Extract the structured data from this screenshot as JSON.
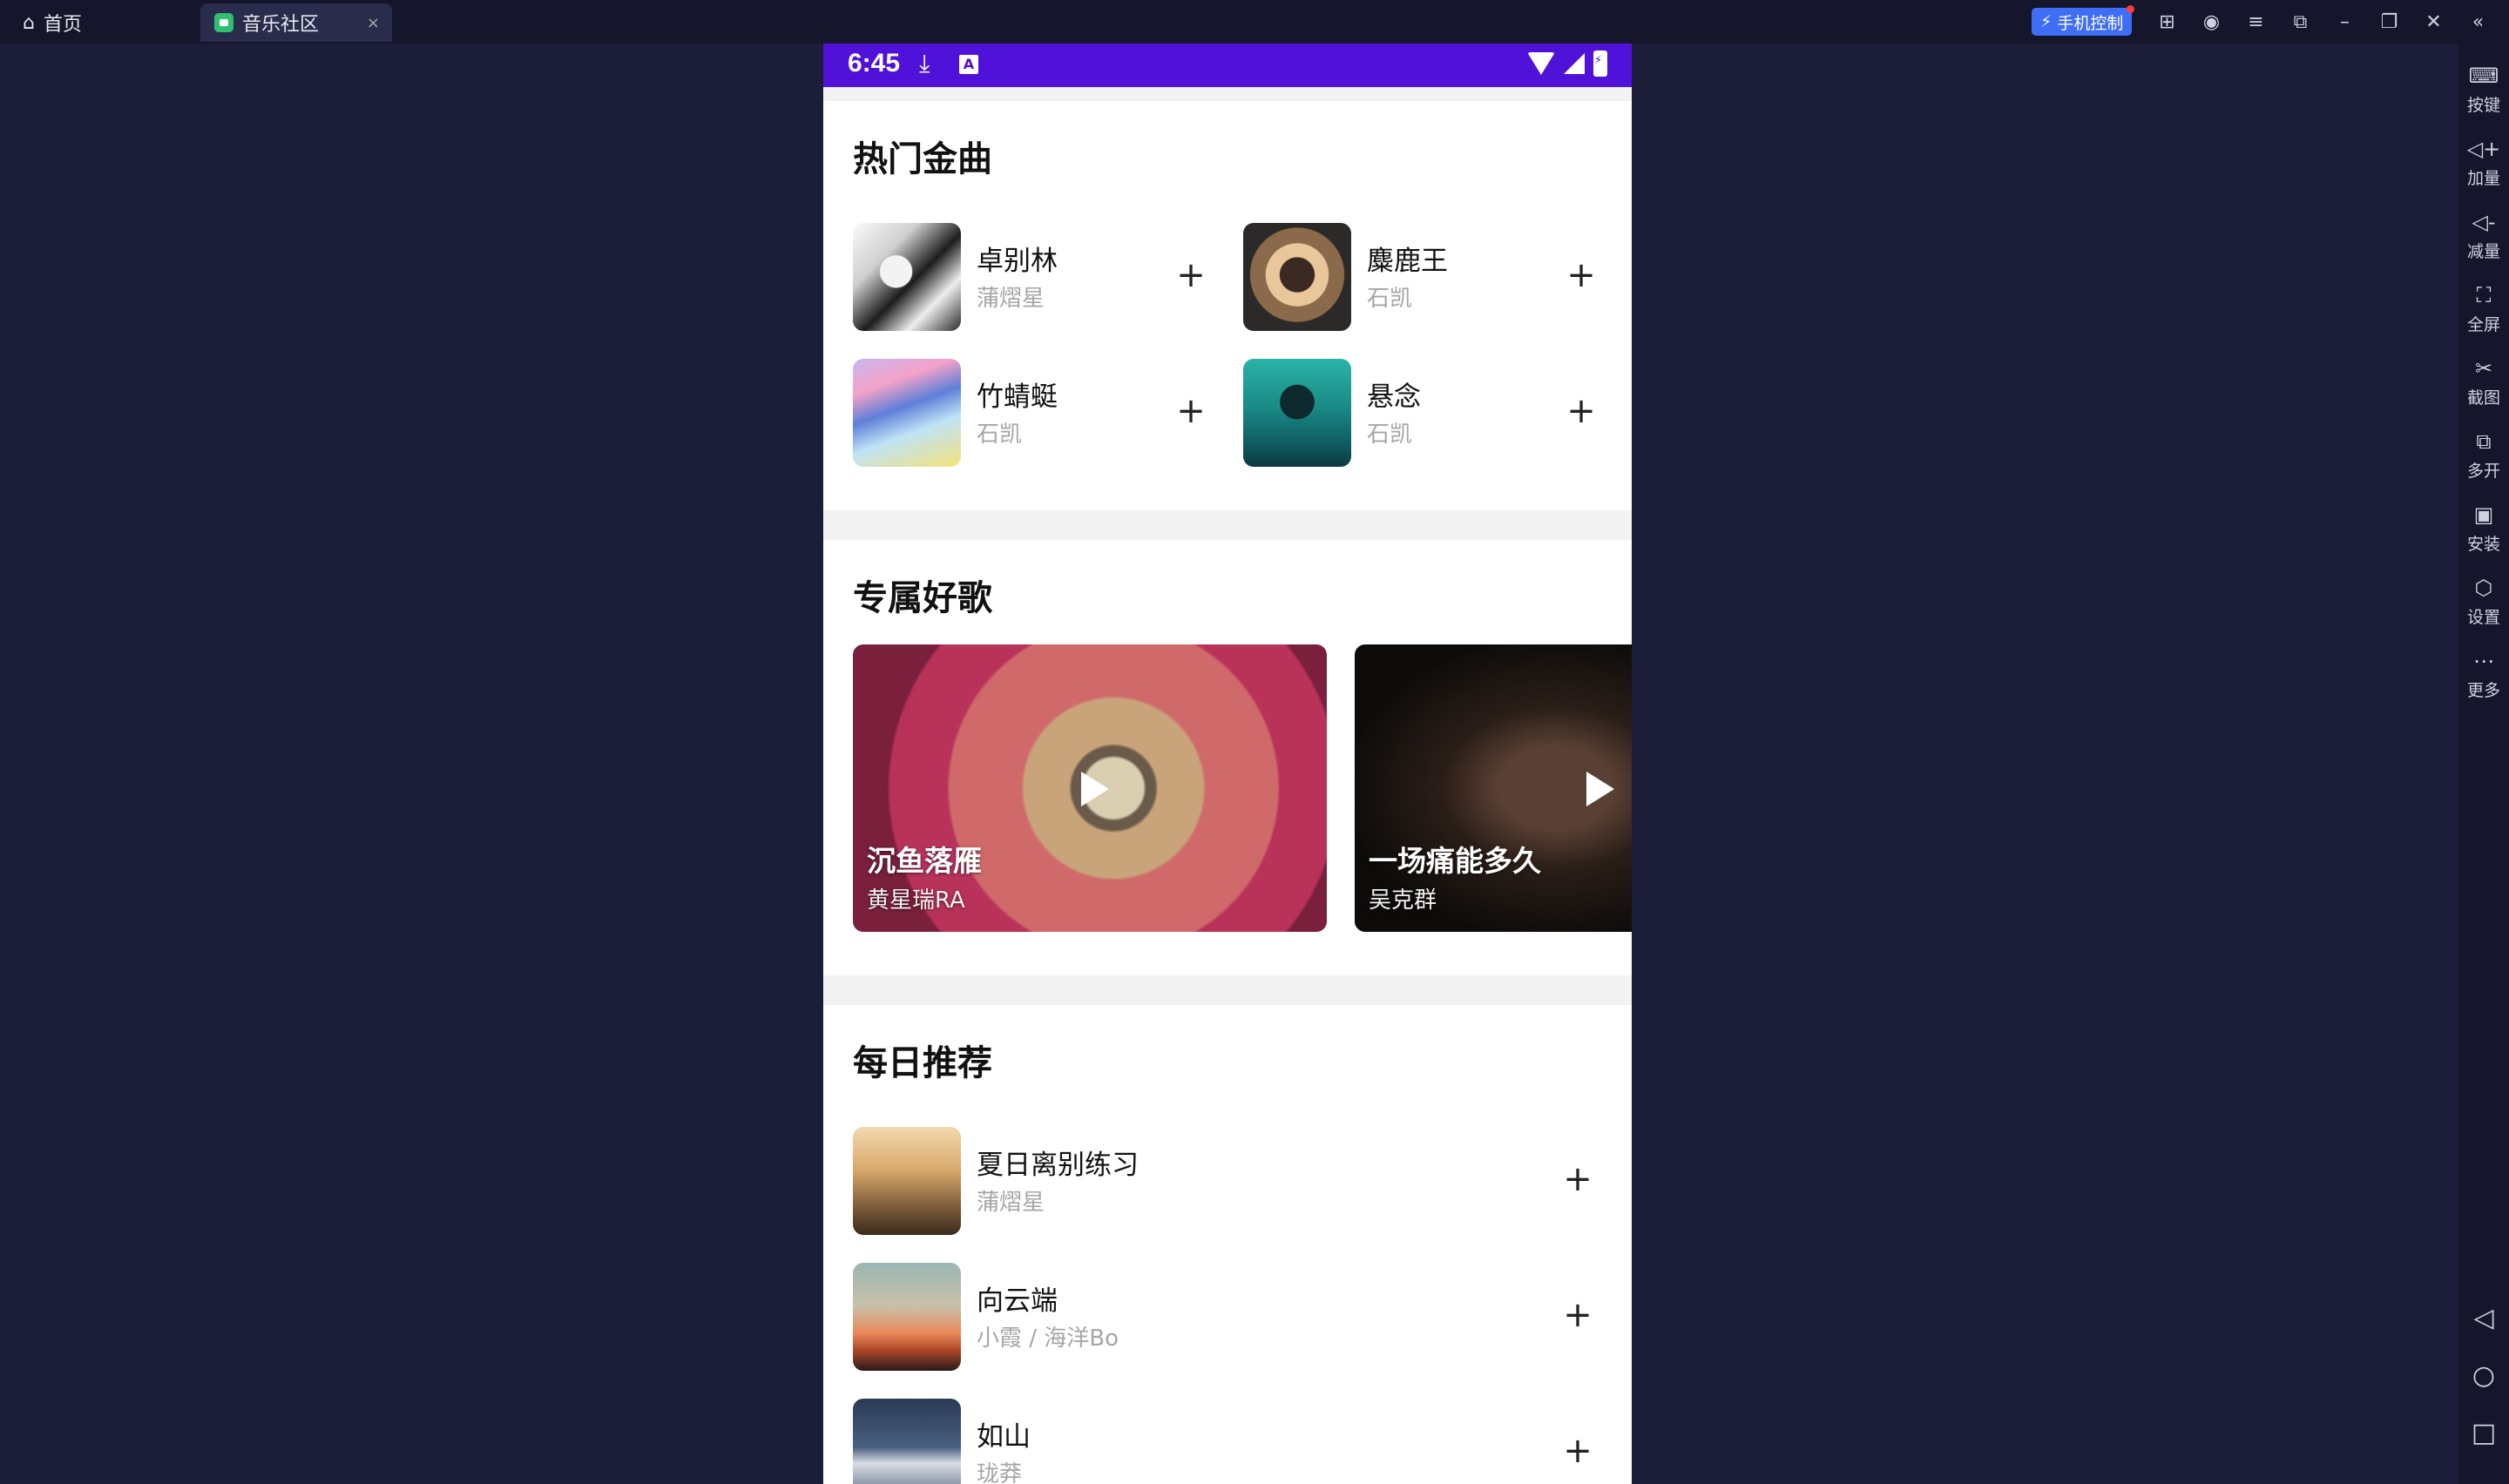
{
  "window": {
    "home_tab": "首页",
    "app_tab": "音乐社区",
    "close_symbol": "×",
    "phone_control": "手机控制"
  },
  "sidebar": [
    {
      "label": "按键",
      "icon": "keyboard-icon"
    },
    {
      "label": "加量",
      "icon": "volume-up-icon"
    },
    {
      "label": "减量",
      "icon": "volume-down-icon"
    },
    {
      "label": "全屏",
      "icon": "fullscreen-icon"
    },
    {
      "label": "截图",
      "icon": "screenshot-icon"
    },
    {
      "label": "多开",
      "icon": "multi-instance-icon"
    },
    {
      "label": "安装",
      "icon": "apk-install-icon"
    },
    {
      "label": "设置",
      "icon": "settings-icon"
    },
    {
      "label": "更多",
      "icon": "more-icon"
    }
  ],
  "status_bar": {
    "time": "6:45"
  },
  "hot_songs": {
    "title": "热门金曲",
    "items": [
      {
        "title": "卓别林",
        "artist": "蒲熠星"
      },
      {
        "title": "麋鹿王",
        "artist": "石凯"
      },
      {
        "title": "竹蜻蜓",
        "artist": "石凯"
      },
      {
        "title": "悬念",
        "artist": "石凯"
      }
    ]
  },
  "exclusive": {
    "title": "专属好歌",
    "items": [
      {
        "title": "沉鱼落雁",
        "artist": "黄星瑞RA"
      },
      {
        "title": "一场痛能多久",
        "artist": "吴克群"
      }
    ]
  },
  "daily": {
    "title": "每日推荐",
    "items": [
      {
        "title": "夏日离别练习",
        "artist": "蒲熠星"
      },
      {
        "title": "向云端",
        "artist": "小霞 / 海洋Bo"
      },
      {
        "title": "如山",
        "artist": "珑莽"
      }
    ]
  },
  "add_symbol": "+"
}
